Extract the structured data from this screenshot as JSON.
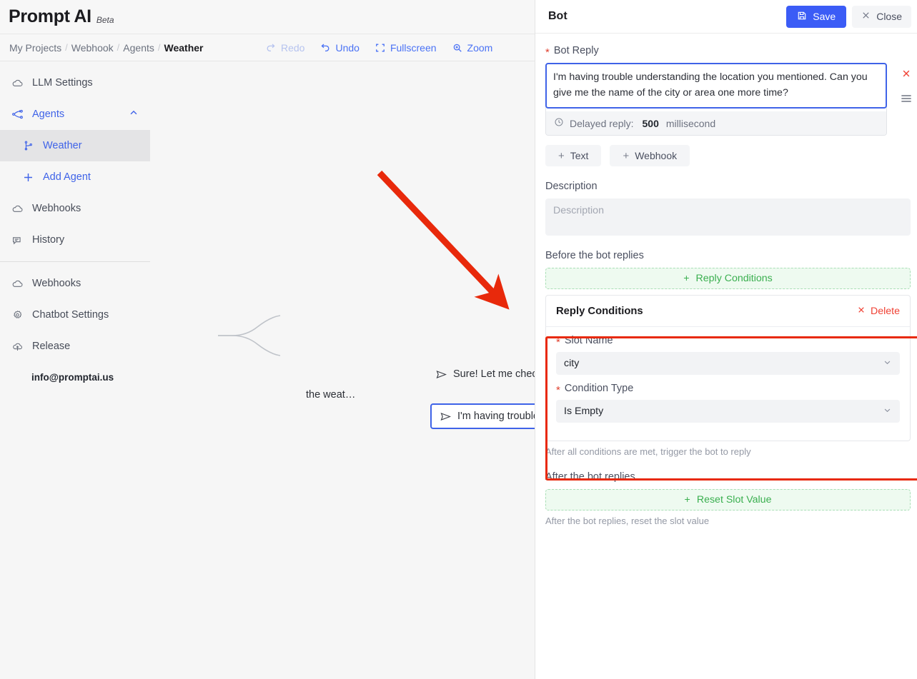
{
  "brand": {
    "name": "Prompt AI",
    "tag": "Beta"
  },
  "breadcrumb": {
    "items": [
      "My Projects",
      "Webhook",
      "Agents",
      "Weather"
    ],
    "separator": "/"
  },
  "toolbar": {
    "redo": "Redo",
    "undo": "Undo",
    "fullscreen": "Fullscreen",
    "zoom": "Zoom"
  },
  "sidebar": {
    "items": [
      {
        "label": "LLM Settings",
        "icon": "cloud-icon"
      },
      {
        "label": "Agents",
        "icon": "flow-branch-icon"
      },
      {
        "label": "Weather",
        "icon": "git-branch-icon"
      },
      {
        "label": "Add Agent",
        "icon": "plus-icon"
      },
      {
        "label": "Webhooks",
        "icon": "cloud-icon"
      },
      {
        "label": "History",
        "icon": "chat-history-icon"
      },
      {
        "label": "Webhooks",
        "icon": "cloud-icon"
      },
      {
        "label": "Chatbot Settings",
        "icon": "gear-icon"
      },
      {
        "label": "Release",
        "icon": "cloud-upload-icon"
      }
    ],
    "footer_email": "info@promptai.us"
  },
  "canvas": {
    "nodes": [
      {
        "label": "the weat…",
        "type": "user-utterance"
      },
      {
        "label": "Sure! Let me check the curr…",
        "type": "bot-reply"
      },
      {
        "label": "I'm having trouble understan…",
        "type": "bot-reply-selected"
      }
    ]
  },
  "panel": {
    "title": "Bot",
    "save_label": "Save",
    "close_label": "Close",
    "bot_reply_label": "Bot Reply",
    "bot_reply_text": "I'm having trouble understanding the location you mentioned. Can you give me the name of the city or area one more time?",
    "delay_label": "Delayed reply:",
    "delay_value": "500",
    "delay_unit": "millisecond",
    "add_text_label": "Text",
    "add_webhook_label": "Webhook",
    "description_label": "Description",
    "description_value": "",
    "description_placeholder": "Description",
    "before_label": "Before the bot replies",
    "add_reply_conditions_label": "Reply Conditions",
    "condition_card": {
      "title": "Reply Conditions",
      "delete_label": "Delete",
      "slot_name_label": "Slot Name",
      "slot_name_value": "city",
      "condition_type_label": "Condition Type",
      "condition_type_value": "Is Empty"
    },
    "before_hint": "After all conditions are met, trigger the bot to reply",
    "after_label": "After the bot replies",
    "reset_slot_label": "Reset Slot Value",
    "after_hint": "After the bot replies, reset the slot value"
  },
  "colors": {
    "accent_blue": "#3b5cf6",
    "link_blue": "#4a72f5",
    "danger_red": "#f04134",
    "highlight_red": "#e8290b",
    "green": "#3aaf4f",
    "green_bg": "#eefaf0"
  }
}
